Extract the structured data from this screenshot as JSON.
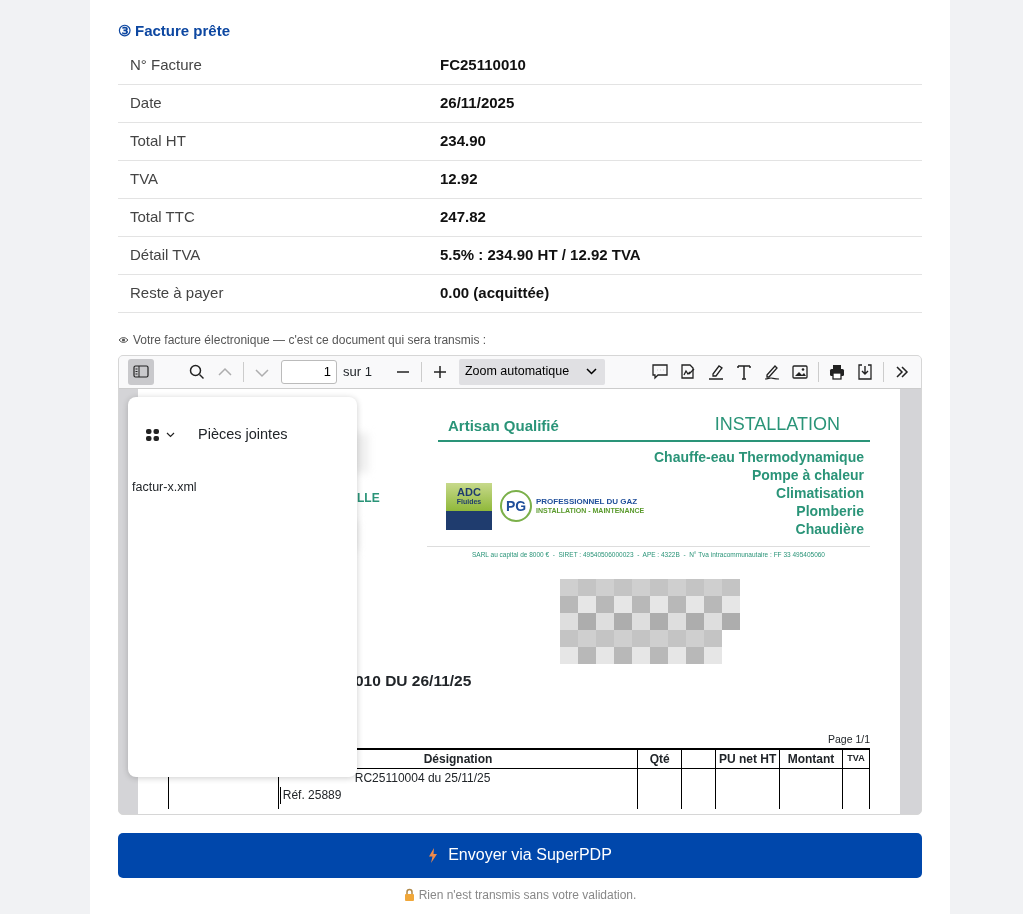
{
  "section": {
    "step": "③",
    "title": "Facture prête"
  },
  "details": [
    {
      "label": "N° Facture",
      "value": "FC25110010"
    },
    {
      "label": "Date",
      "value": "26/11/2025"
    },
    {
      "label": "Total HT",
      "value": "234.90"
    },
    {
      "label": "TVA",
      "value": "12.92"
    },
    {
      "label": "Total TTC",
      "value": "247.82"
    },
    {
      "label": "Détail TVA",
      "value": "5.5% : 234.90 HT / 12.92 TVA"
    },
    {
      "label": "Reste à payer",
      "value": "0.00 (acquittée)"
    }
  ],
  "preview_caption": "Votre facture électronique — c'est ce document qui sera transmis :",
  "viewer": {
    "toolbar": {
      "sidebar_toggle": {
        "selected": true
      },
      "nav_buttons": [
        {
          "kind": "previous",
          "disabled": true
        },
        {
          "kind": "next",
          "disabled": true
        }
      ],
      "page_number": "1",
      "page_count": "sur 1",
      "zoom": "Zoom automatique"
    },
    "sidebar": {
      "title": "Pièces jointes",
      "attachments": [
        "factur-x.xml"
      ]
    },
    "document": {
      "left_fragment": "LLE",
      "tagline": "Artisan Qualifié",
      "heading": "INSTALLATION",
      "services": [
        "Chauffe-eau Thermodynamique",
        "Pompe à chaleur",
        "Climatisation",
        "Plomberie",
        "Chaudière"
      ],
      "logo_adc": [
        "ADC",
        "Fluides"
      ],
      "logo_pg": {
        "mark": "PG",
        "name": "PROFESSIONNEL DU GAZ",
        "subtitle": "INSTALLATION - MAINTENANCE"
      },
      "legal_line": "SARL au capital de 8000 €  -  SIRET : 49540506000023  -  APE : 4322B  -  N° Tva intracommunautaire : FF 33 495405060",
      "invoice_title": "010 DU 26/11/25",
      "page_label": "Page 1/1",
      "table": {
        "columns": [
          "",
          "Désignation",
          "Qté",
          "",
          "PU net HT",
          "Montant",
          "TVA"
        ],
        "lines": [
          "RC25110004 du 25/11/25",
          "Réf. 25889"
        ]
      }
    }
  },
  "send_button": "Envoyer via SuperPDP",
  "note": "Rien n'est transmis sans votre validation."
}
